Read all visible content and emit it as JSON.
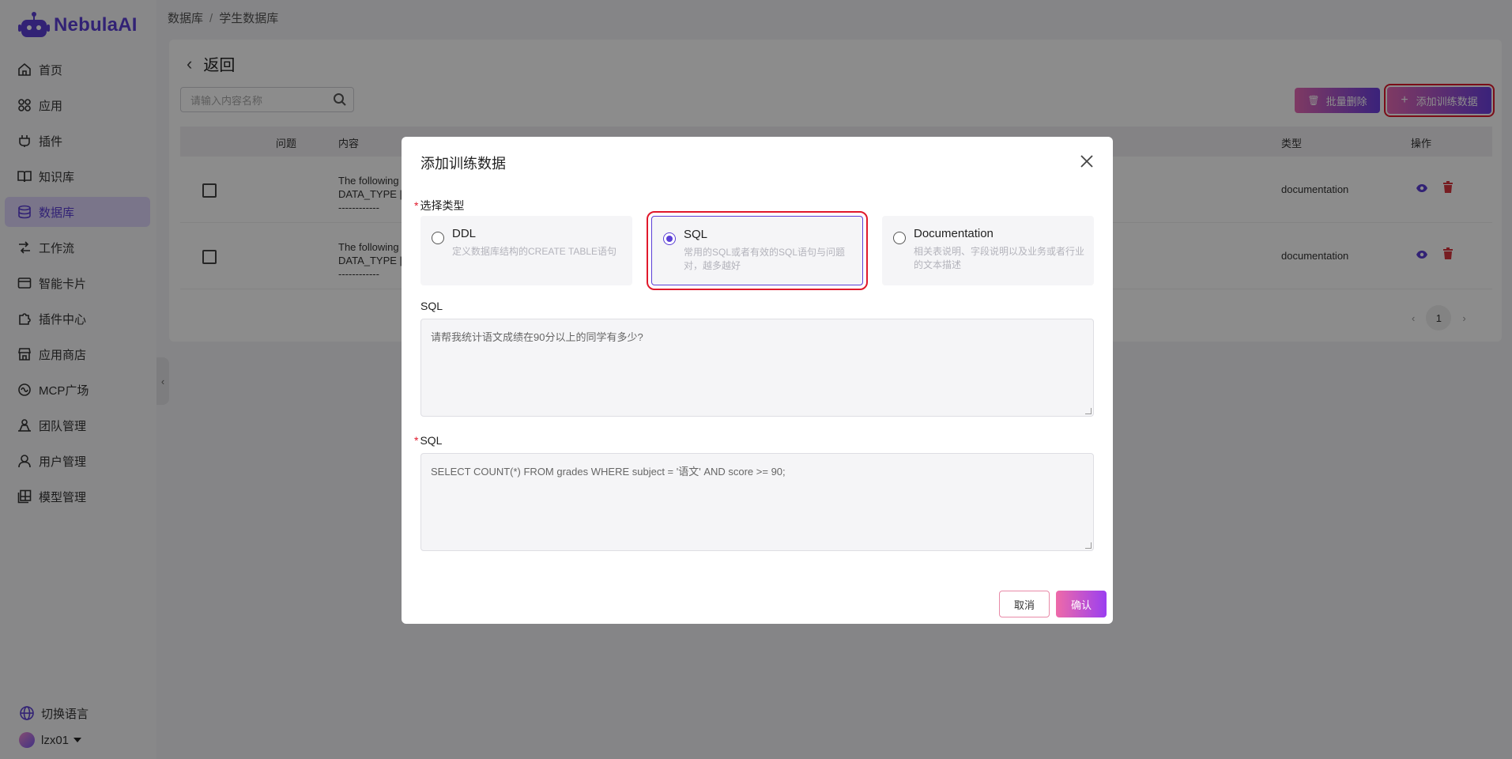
{
  "app": {
    "name": "NebulaAI"
  },
  "sidebar": {
    "items": [
      {
        "label": "首页",
        "icon": "home-icon"
      },
      {
        "label": "应用",
        "icon": "apps-icon"
      },
      {
        "label": "插件",
        "icon": "plugin-icon"
      },
      {
        "label": "知识库",
        "icon": "book-icon"
      },
      {
        "label": "数据库",
        "icon": "database-icon",
        "active": true
      },
      {
        "label": "工作流",
        "icon": "workflow-icon"
      },
      {
        "label": "智能卡片",
        "icon": "card-icon"
      },
      {
        "label": "插件中心",
        "icon": "puzzle-icon"
      },
      {
        "label": "应用商店",
        "icon": "store-icon"
      },
      {
        "label": "MCP广场",
        "icon": "mcp-icon"
      },
      {
        "label": "团队管理",
        "icon": "team-icon"
      },
      {
        "label": "用户管理",
        "icon": "user-icon"
      },
      {
        "label": "模型管理",
        "icon": "model-icon"
      }
    ],
    "language_label": "切换语言",
    "username": "lzx01"
  },
  "breadcrumb": {
    "root": "数据库",
    "separator": "/",
    "current": "学生数据库"
  },
  "page": {
    "back_label": "返回",
    "search_placeholder": "请输入内容名称",
    "batch_delete_label": "批量删除",
    "add_training_label": "添加训练数据",
    "table": {
      "headers": {
        "question": "问题",
        "content": "内容",
        "type": "类型",
        "actions": "操作"
      },
      "rows": [
        {
          "content_line1": "The following",
          "content_line2": "DATA_TYPE |",
          "content_line3": "------------",
          "type": "documentation"
        },
        {
          "content_line1": "The following",
          "content_line2": "DATA_TYPE |",
          "content_line3": "------------",
          "type": "documentation"
        }
      ]
    },
    "pagination": {
      "current_page": "1"
    }
  },
  "modal": {
    "title": "添加训练数据",
    "type_label": "选择类型",
    "types": [
      {
        "title": "DDL",
        "desc": "定义数据库结构的CREATE TABLE语句"
      },
      {
        "title": "SQL",
        "desc": "常用的SQL或者有效的SQL语句与问题对，越多越好",
        "selected": true
      },
      {
        "title": "Documentation",
        "desc": "相关表说明、字段说明以及业务或者行业的文本描述"
      }
    ],
    "question_label": "SQL",
    "question_value": "请帮我统计语文成绩在90分以上的同学有多少?",
    "sql_label": "SQL",
    "sql_value": "SELECT COUNT(*)  FROM grades WHERE subject = '语文' AND score >= 90;",
    "cancel_label": "取消",
    "confirm_label": "确认"
  },
  "colors": {
    "accent": "#5b3fd6",
    "highlight": "#e0192c",
    "danger": "#d9363e"
  }
}
